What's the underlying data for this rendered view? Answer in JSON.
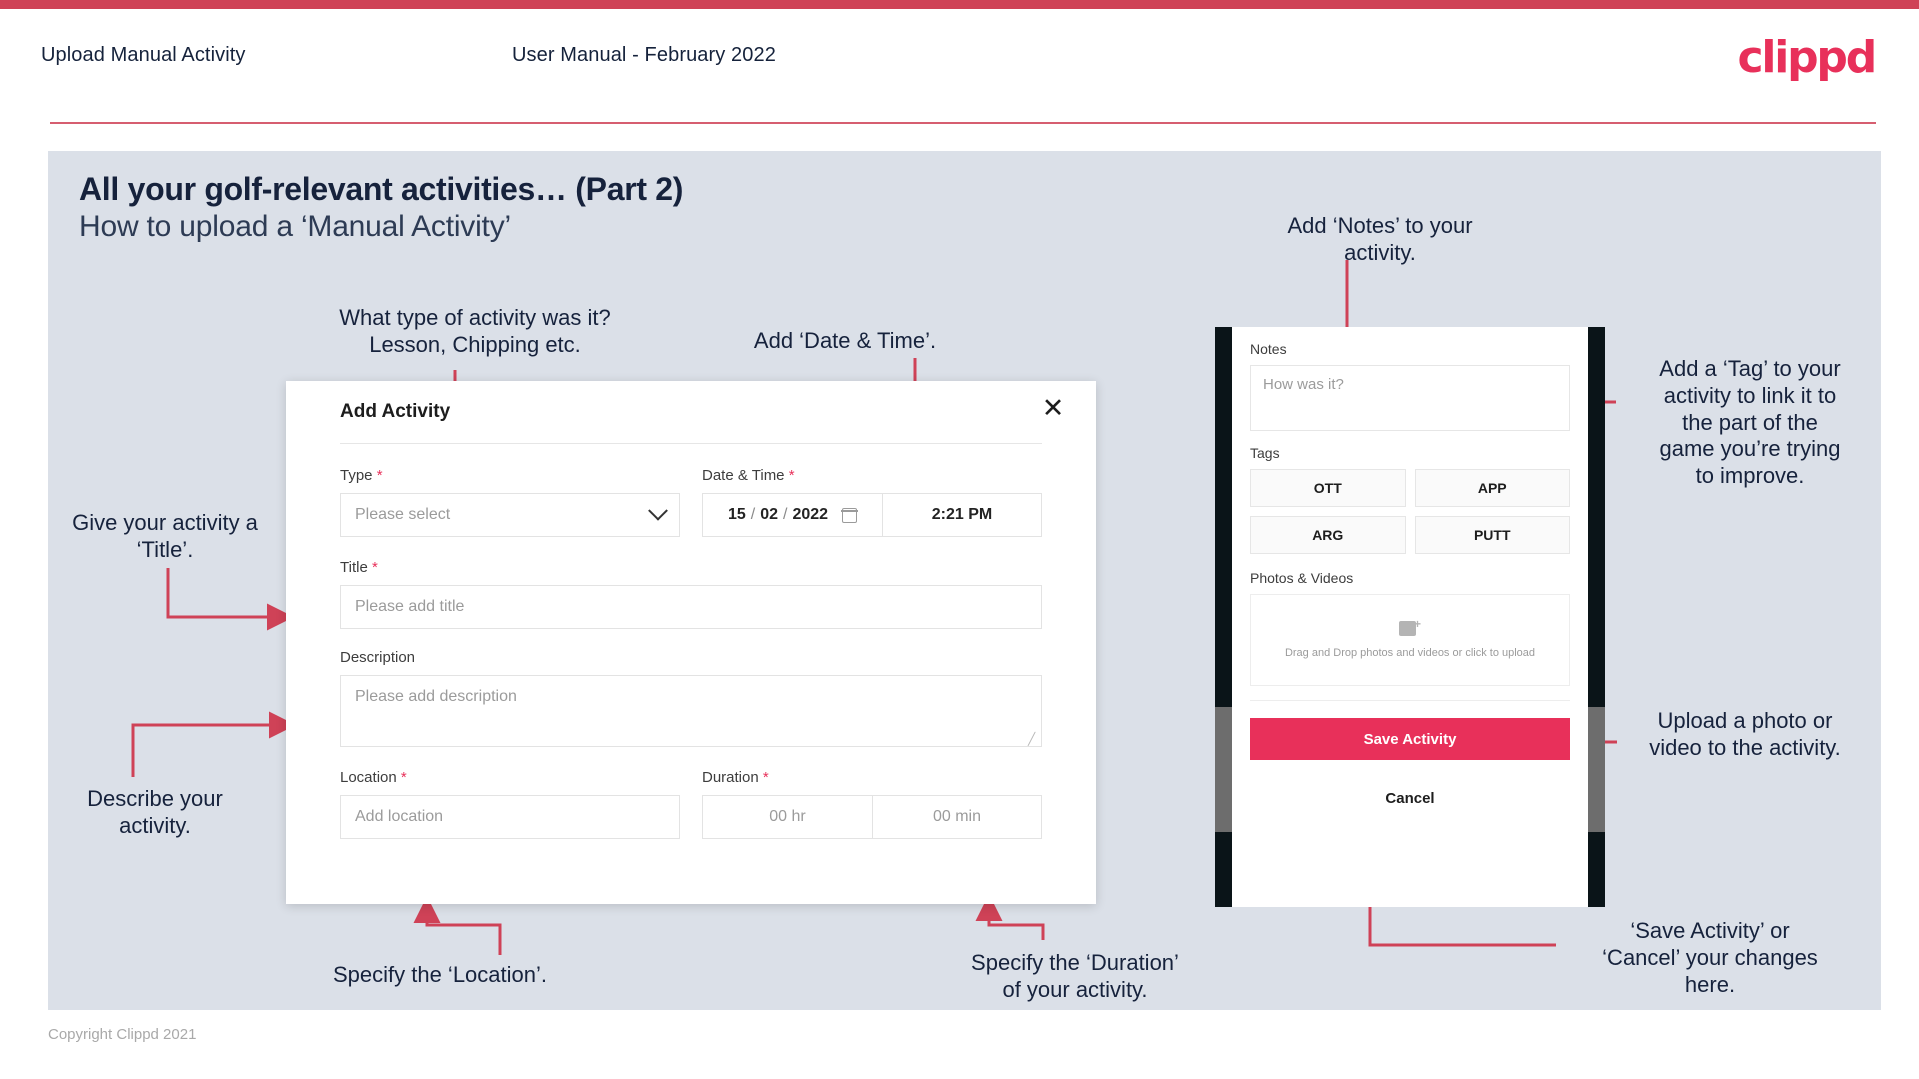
{
  "header": {
    "title": "Upload Manual Activity",
    "subtitle": "User Manual - February 2022",
    "logo": "clippd"
  },
  "slide": {
    "title": "All your golf-relevant activities… (Part 2)",
    "subtitle": "How to upload a ‘Manual Activity’"
  },
  "annotations": {
    "type": "What type of activity was it?\nLesson, Chipping etc.",
    "datetime": "Add ‘Date & Time’.",
    "title": "Give your activity a\n‘Title’.",
    "description": "Describe your\nactivity.",
    "location": "Specify the ‘Location’.",
    "duration": "Specify the ‘Duration’\nof your activity.",
    "notes": "Add ‘Notes’ to your\nactivity.",
    "tags": "Add a ‘Tag’ to your\nactivity to link it to\nthe part of the\ngame you’re trying\nto improve.",
    "upload": "Upload a photo or\nvideo to the activity.",
    "save": "‘Save Activity’ or\n‘Cancel’ your changes\nhere."
  },
  "modal": {
    "title": "Add Activity",
    "close_icon": "close-icon",
    "fields": {
      "type": {
        "label": "Type",
        "required": true,
        "placeholder": "Please select"
      },
      "datetime": {
        "label": "Date & Time",
        "required": true,
        "day": "15",
        "month": "02",
        "year": "2022",
        "time": "2:21 PM"
      },
      "title": {
        "label": "Title",
        "required": true,
        "placeholder": "Please add title"
      },
      "description": {
        "label": "Description",
        "required": false,
        "placeholder": "Please add description"
      },
      "location": {
        "label": "Location",
        "required": true,
        "placeholder": "Add location"
      },
      "duration": {
        "label": "Duration",
        "required": true,
        "hours": "00 hr",
        "minutes": "00 min"
      }
    }
  },
  "phone": {
    "notes": {
      "label": "Notes",
      "placeholder": "How was it?"
    },
    "tags": {
      "label": "Tags",
      "items": [
        "OTT",
        "APP",
        "ARG",
        "PUTT"
      ]
    },
    "photos": {
      "label": "Photos & Videos",
      "drop_text": "Drag and Drop photos and videos or click to upload",
      "icon": "add-image-icon"
    },
    "save_label": "Save Activity",
    "cancel_label": "Cancel"
  },
  "footer": {
    "copyright": "Copyright Clippd 2021"
  },
  "colors": {
    "accent": "#e8305a",
    "stripe": "#cf4257",
    "slide_bg": "#dbe0e8",
    "text_dark": "#16223c"
  }
}
